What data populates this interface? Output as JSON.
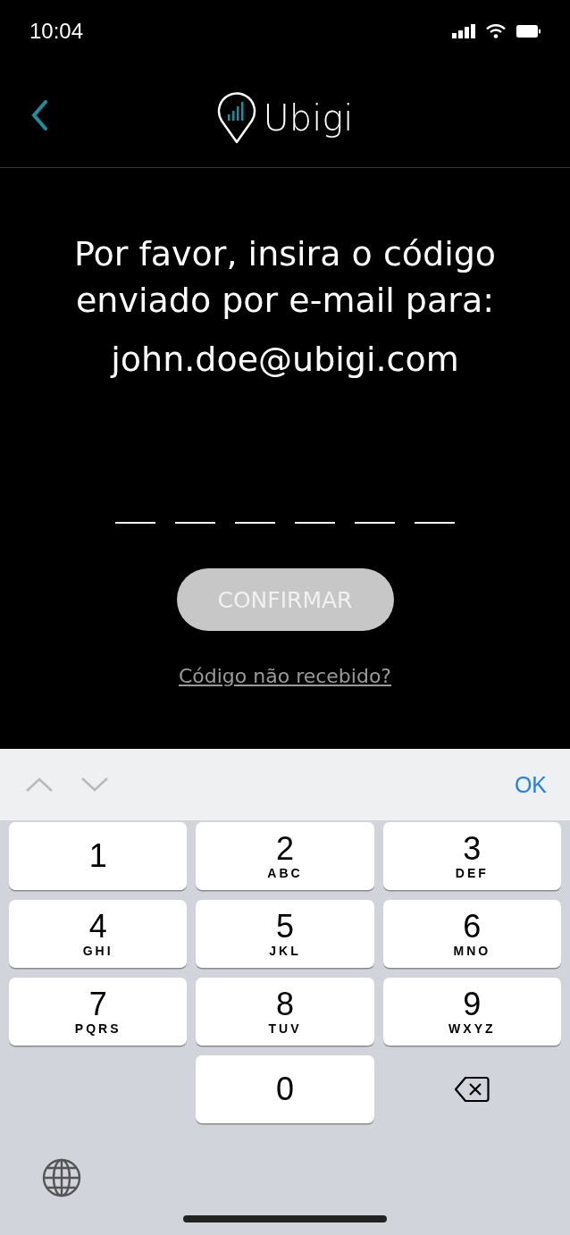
{
  "status_bar": {
    "time": "10:04"
  },
  "header": {
    "brand": "Ubigi"
  },
  "prompt": {
    "lines": [
      "Por favor, insira o código",
      "enviado por e-mail para:"
    ],
    "email": "john.doe@ubigi.com"
  },
  "code_slots": [
    {
      "filled": false
    },
    {
      "filled": false
    },
    {
      "filled": false
    },
    {
      "filled": false
    },
    {
      "filled": false
    },
    {
      "filled": false
    }
  ],
  "confirm_button": {
    "label": "CONFIRMAR",
    "disabled": true
  },
  "resend_link": "Código não recebido?",
  "accessory_bar": {
    "done": "OK"
  },
  "keys": [
    {
      "kind": "digit",
      "digit": "1"
    },
    {
      "kind": "digit",
      "digit": "2",
      "letters": "ABC"
    },
    {
      "kind": "digit",
      "digit": "3",
      "letters": "DEF"
    },
    {
      "kind": "digit",
      "digit": "4",
      "letters": "GHI"
    },
    {
      "kind": "digit",
      "digit": "5",
      "letters": "JKL"
    },
    {
      "kind": "digit",
      "digit": "6",
      "letters": "MNO"
    },
    {
      "kind": "digit",
      "digit": "7",
      "letters": "PQRS"
    },
    {
      "kind": "digit",
      "digit": "8",
      "letters": "TUV"
    },
    {
      "kind": "digit",
      "digit": "9",
      "letters": "WXYZ"
    },
    {
      "kind": "blank"
    },
    {
      "kind": "digit",
      "digit": "0"
    },
    {
      "kind": "delete"
    }
  ]
}
